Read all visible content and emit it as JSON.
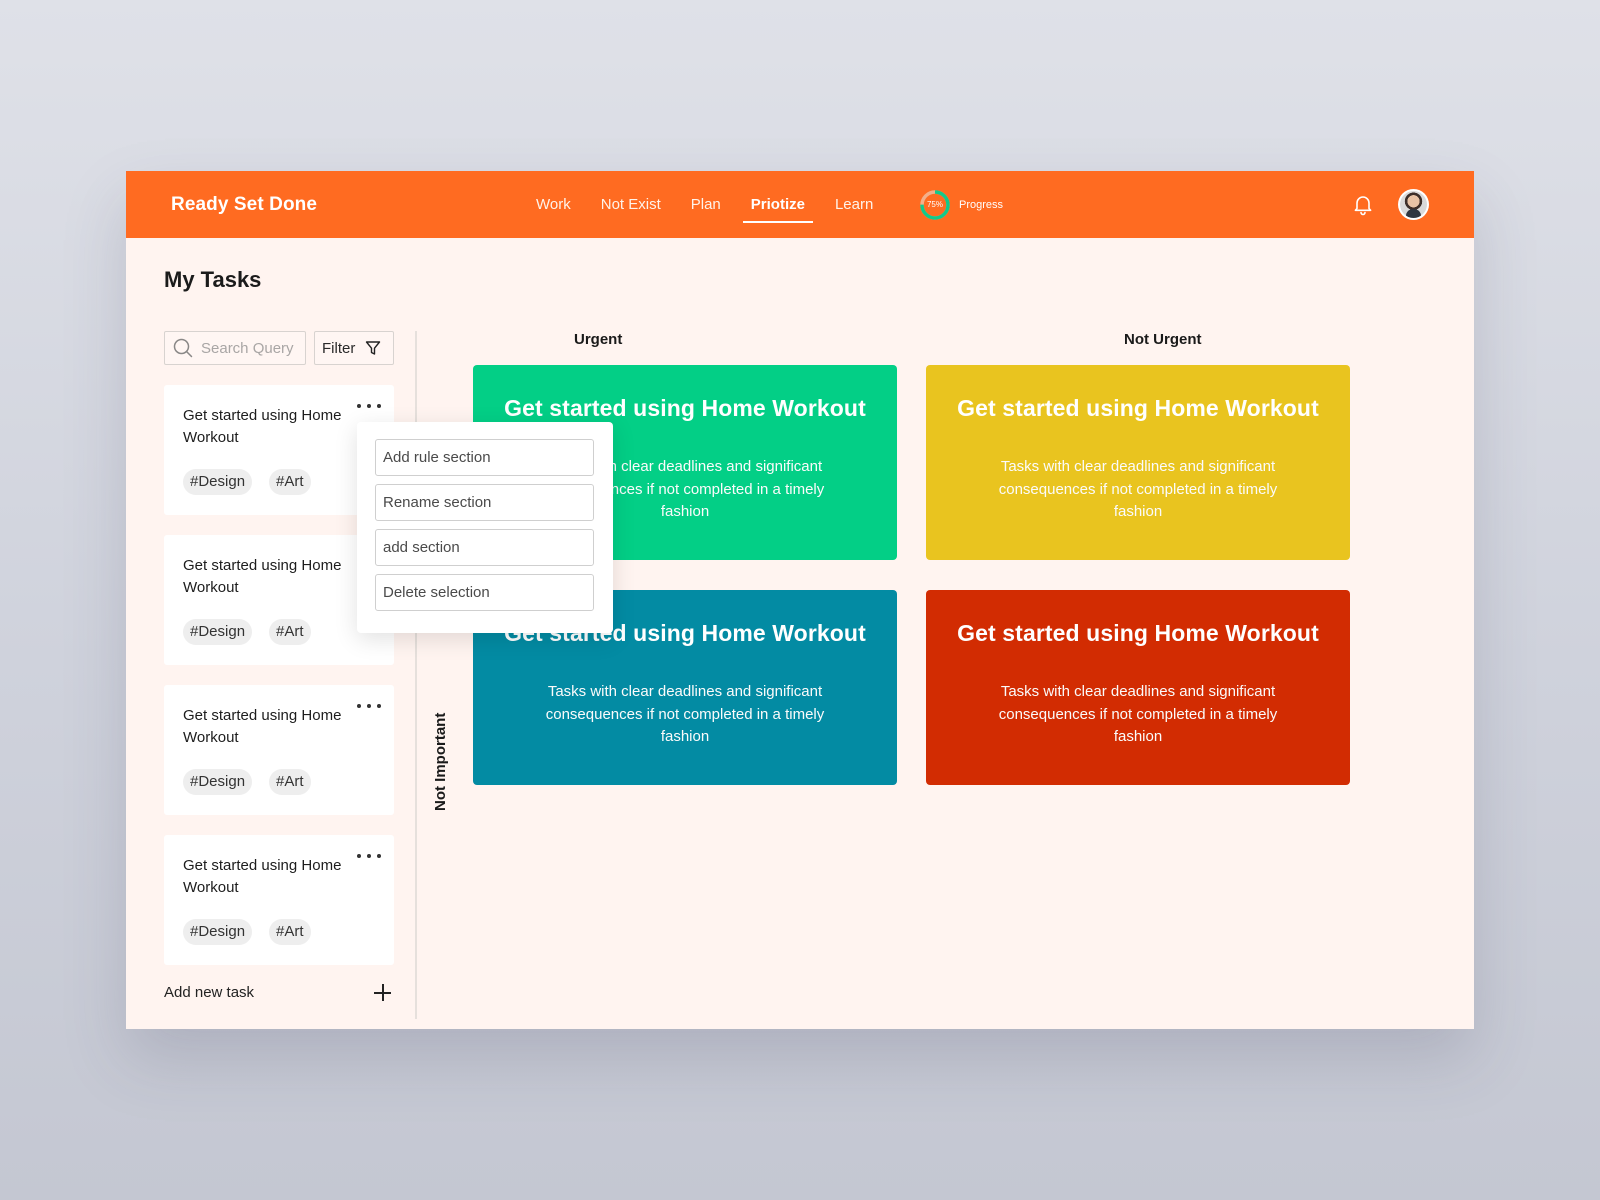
{
  "app": {
    "brand": "Ready Set Done",
    "nav": [
      "Work",
      "Not Exist",
      "Plan",
      "Priotize",
      "Learn"
    ],
    "active_nav": "Priotize",
    "progress": {
      "value_percent": 75,
      "text": "75%",
      "label": "Progress"
    },
    "colors": {
      "primary": "#ff6b21",
      "background": "#fff4f0"
    },
    "icons": {
      "bell": "bell-icon",
      "avatar": "user-avatar"
    }
  },
  "page": {
    "title": "My Tasks"
  },
  "sidebar": {
    "search_placeholder": "Search Query",
    "filter_label": "Filter",
    "tasks": [
      {
        "title": "Get started using Home Workout",
        "tags": [
          "#Design",
          "#Art"
        ]
      },
      {
        "title": "Get started using Home Workout",
        "tags": [
          "#Design",
          "#Art"
        ]
      },
      {
        "title": "Get started using Home Workout",
        "tags": [
          "#Design",
          "#Art"
        ]
      },
      {
        "title": "Get started using Home Workout",
        "tags": [
          "#Design",
          "#Art"
        ]
      }
    ],
    "add_task_label": "Add new task"
  },
  "context_menu": {
    "items": [
      "Add rule section",
      "Rename section",
      "add section",
      "Delete selection"
    ]
  },
  "matrix": {
    "columns": [
      "Urgent",
      "Not Urgent"
    ],
    "row_label": "Not Important",
    "quadrants": [
      {
        "title": "Get started using Home Workout",
        "description": "Tasks with clear deadlines and significant consequences if not completed in a timely fashion",
        "color": "#03cf86"
      },
      {
        "title": "Get started using Home Workout",
        "description": "Tasks with clear deadlines and significant consequences if not completed in a timely fashion",
        "color": "#e9c41f"
      },
      {
        "title": "Get started using Home Workout",
        "description": "Tasks with clear deadlines and significant consequences if not completed in a timely fashion",
        "color": "#038ba3"
      },
      {
        "title": "Get started using Home Workout",
        "description": "Tasks with clear deadlines and significant consequences if not completed in a timely fashion",
        "color": "#d22c02"
      }
    ]
  }
}
